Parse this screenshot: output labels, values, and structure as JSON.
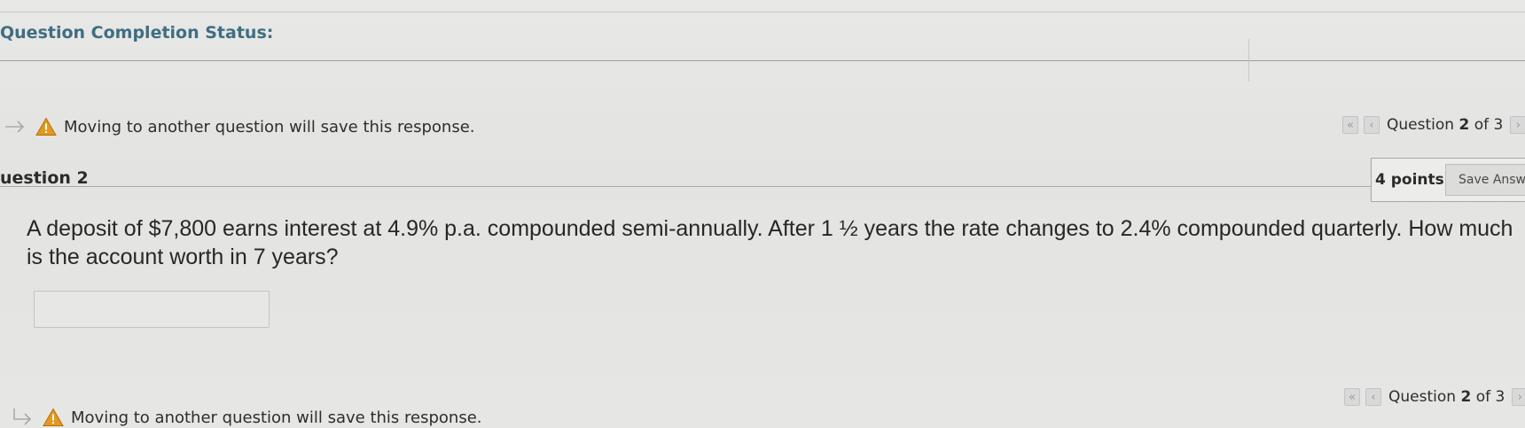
{
  "status": {
    "title": "Question Completion Status:"
  },
  "warning": {
    "top_text": "Moving to another question will save this response.",
    "bottom_text": "Moving to another question will save this response.",
    "icon": "warning-triangle-icon",
    "arrow_icon": "arrow-right-icon",
    "color": "#e09a1c"
  },
  "navigation": {
    "prefix": "Question",
    "current": "2",
    "separator": "of",
    "total": "3",
    "first_glyph": "«",
    "prev_glyph": "‹",
    "next_glyph": "›"
  },
  "question": {
    "title": "uestion 2",
    "points": "4 points",
    "save_label": "Save Answer",
    "text": "A deposit of $7,800 earns interest at 4.9% p.a. compounded semi-annually. After 1 ½ years the rate changes to 2.4% compounded quarterly. How much is the account worth in 7 years?",
    "answer_value": ""
  },
  "colors": {
    "status_title": "#3f6e83",
    "background": "#e6e6e4"
  }
}
